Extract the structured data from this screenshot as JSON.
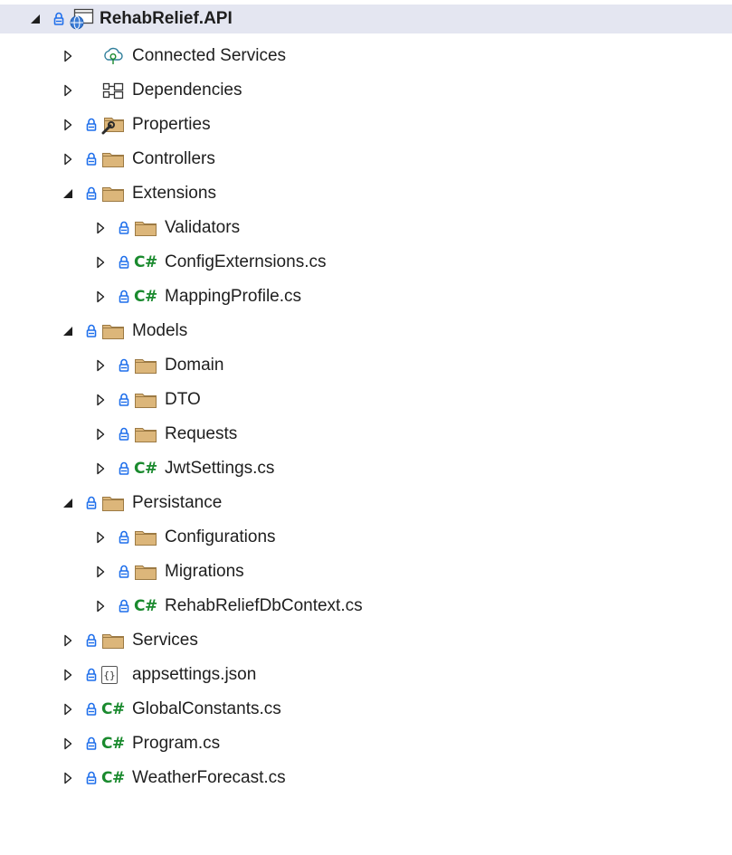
{
  "colors": {
    "selection_background": "#e4e6f1",
    "folder_fill": "#dcb67a",
    "folder_border": "#9c7a44",
    "lock_color": "#1f6feb",
    "csharp_color": "#1a8a2e",
    "text_color": "#1e1e1e"
  },
  "tree": {
    "items": [
      {
        "label": "RehabRelief.API",
        "icon": "web-project-icon",
        "expanded": true,
        "locked": true,
        "selected": true,
        "bold": true
      },
      {
        "label": "Connected Services",
        "icon": "connected-services-icon",
        "expanded": false,
        "locked": false
      },
      {
        "label": "Dependencies",
        "icon": "dependencies-icon",
        "expanded": false,
        "locked": false
      },
      {
        "label": "Properties",
        "icon": "properties-folder-icon",
        "expanded": false,
        "locked": true
      },
      {
        "label": "Controllers",
        "icon": "folder-icon",
        "expanded": false,
        "locked": true
      },
      {
        "label": "Extensions",
        "icon": "folder-icon",
        "expanded": true,
        "locked": true
      },
      {
        "label": "Validators",
        "icon": "folder-icon",
        "expanded": false,
        "locked": true
      },
      {
        "label": "ConfigExternsions.cs",
        "icon": "csharp-file-icon",
        "expanded": false,
        "locked": true
      },
      {
        "label": "MappingProfile.cs",
        "icon": "csharp-file-icon",
        "expanded": false,
        "locked": true
      },
      {
        "label": "Models",
        "icon": "folder-icon",
        "expanded": true,
        "locked": true
      },
      {
        "label": "Domain",
        "icon": "folder-icon",
        "expanded": false,
        "locked": true
      },
      {
        "label": "DTO",
        "icon": "folder-icon",
        "expanded": false,
        "locked": true
      },
      {
        "label": "Requests",
        "icon": "folder-icon",
        "expanded": false,
        "locked": true
      },
      {
        "label": "JwtSettings.cs",
        "icon": "csharp-file-icon",
        "expanded": false,
        "locked": true
      },
      {
        "label": "Persistance",
        "icon": "folder-icon",
        "expanded": true,
        "locked": true
      },
      {
        "label": "Configurations",
        "icon": "folder-icon",
        "expanded": false,
        "locked": true
      },
      {
        "label": "Migrations",
        "icon": "folder-icon",
        "expanded": false,
        "locked": true
      },
      {
        "label": "RehabReliefDbContext.cs",
        "icon": "csharp-file-icon",
        "expanded": false,
        "locked": true
      },
      {
        "label": "Services",
        "icon": "folder-icon",
        "expanded": false,
        "locked": true
      },
      {
        "label": "appsettings.json",
        "icon": "json-file-icon",
        "expanded": false,
        "locked": true
      },
      {
        "label": "GlobalConstants.cs",
        "icon": "csharp-file-icon",
        "expanded": false,
        "locked": true
      },
      {
        "label": "Program.cs",
        "icon": "csharp-file-icon",
        "expanded": false,
        "locked": true
      },
      {
        "label": "WeatherForecast.cs",
        "icon": "csharp-file-icon",
        "expanded": false,
        "locked": true
      }
    ]
  },
  "csharp_icon_text": "C#",
  "json_icon_text": "{}"
}
